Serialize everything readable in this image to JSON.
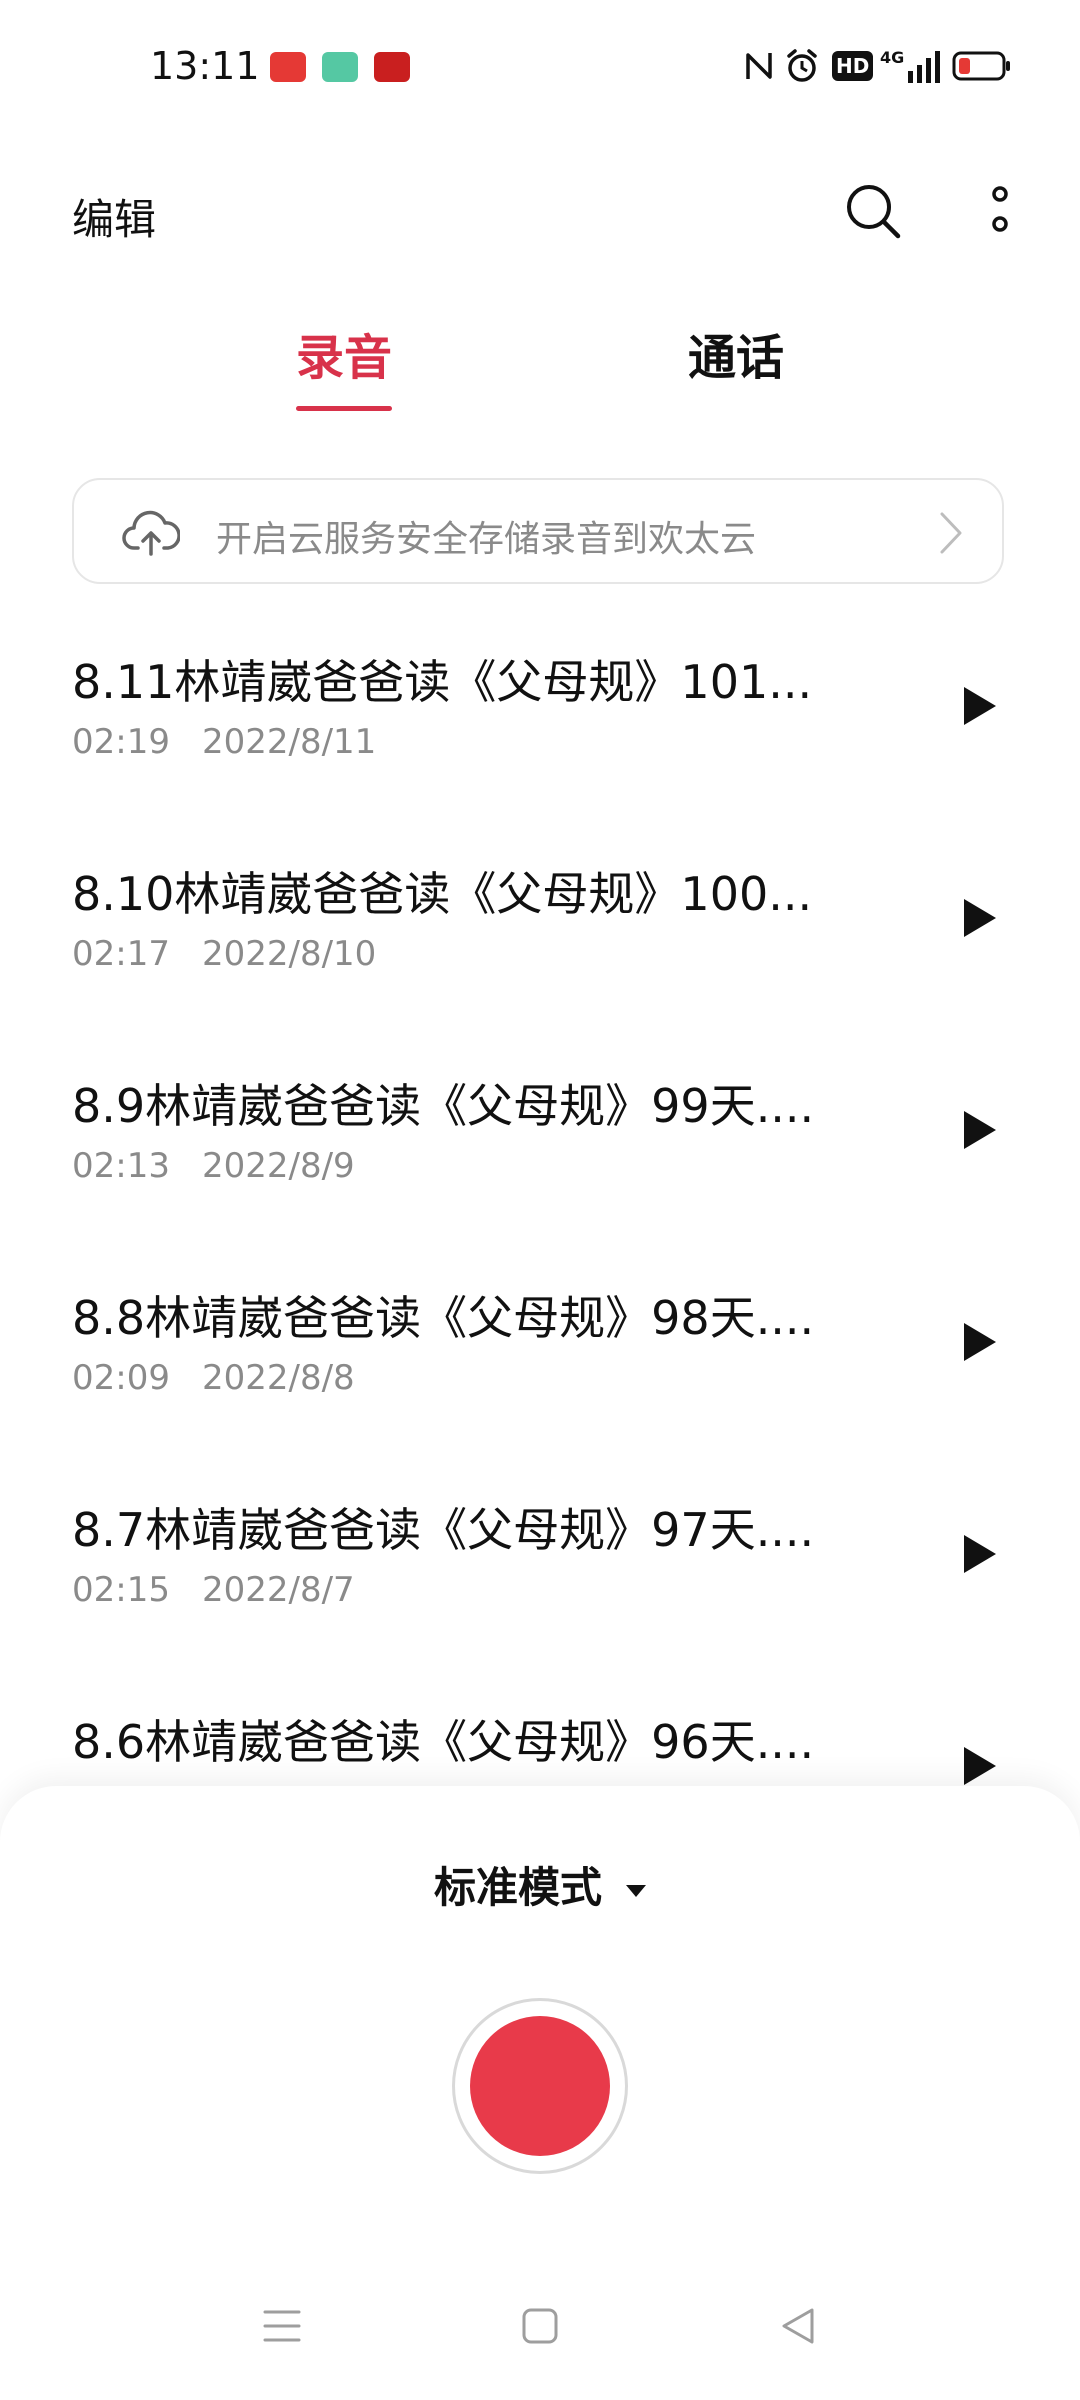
{
  "status_bar": {
    "time": "13:11",
    "notifications": [
      "toutiao-app-icon",
      "green-app-icon",
      "xuexi-app-icon"
    ],
    "indicators": [
      "nfc-icon",
      "alarm-icon",
      "hd-icon",
      "4g-signal-icon",
      "battery-low-icon"
    ],
    "network": "4G",
    "hd_label": "HD"
  },
  "header": {
    "edit_label": "编辑",
    "search_icon": "search-icon",
    "more_icon": "more-vertical-icon"
  },
  "tabs": [
    {
      "label": "录音",
      "active": true
    },
    {
      "label": "通话",
      "active": false
    }
  ],
  "cloud_banner": {
    "icon": "cloud-upload-icon",
    "text": "开启云服务安全存储录音到欢太云"
  },
  "recordings": [
    {
      "title": "8.11林靖崴爸爸读《父母规》101...",
      "duration": "02:19",
      "date": "2022/8/11"
    },
    {
      "title": "8.10林靖崴爸爸读《父母规》100...",
      "duration": "02:17",
      "date": "2022/8/10"
    },
    {
      "title": "8.9林靖崴爸爸读《父母规》99天....",
      "duration": "02:13",
      "date": "2022/8/9"
    },
    {
      "title": "8.8林靖崴爸爸读《父母规》98天....",
      "duration": "02:09",
      "date": "2022/8/8"
    },
    {
      "title": "8.7林靖崴爸爸读《父母规》97天....",
      "duration": "02:15",
      "date": "2022/8/7"
    },
    {
      "title": "8.6林靖崴爸爸读《父母规》96天....",
      "duration": "",
      "date": ""
    }
  ],
  "bottom_panel": {
    "mode_label": "标准模式",
    "record_button_color": "#e83a4a"
  },
  "colors": {
    "accent": "#d8324a",
    "record": "#e83a4a",
    "secondary_text": "#8a8a8a"
  }
}
